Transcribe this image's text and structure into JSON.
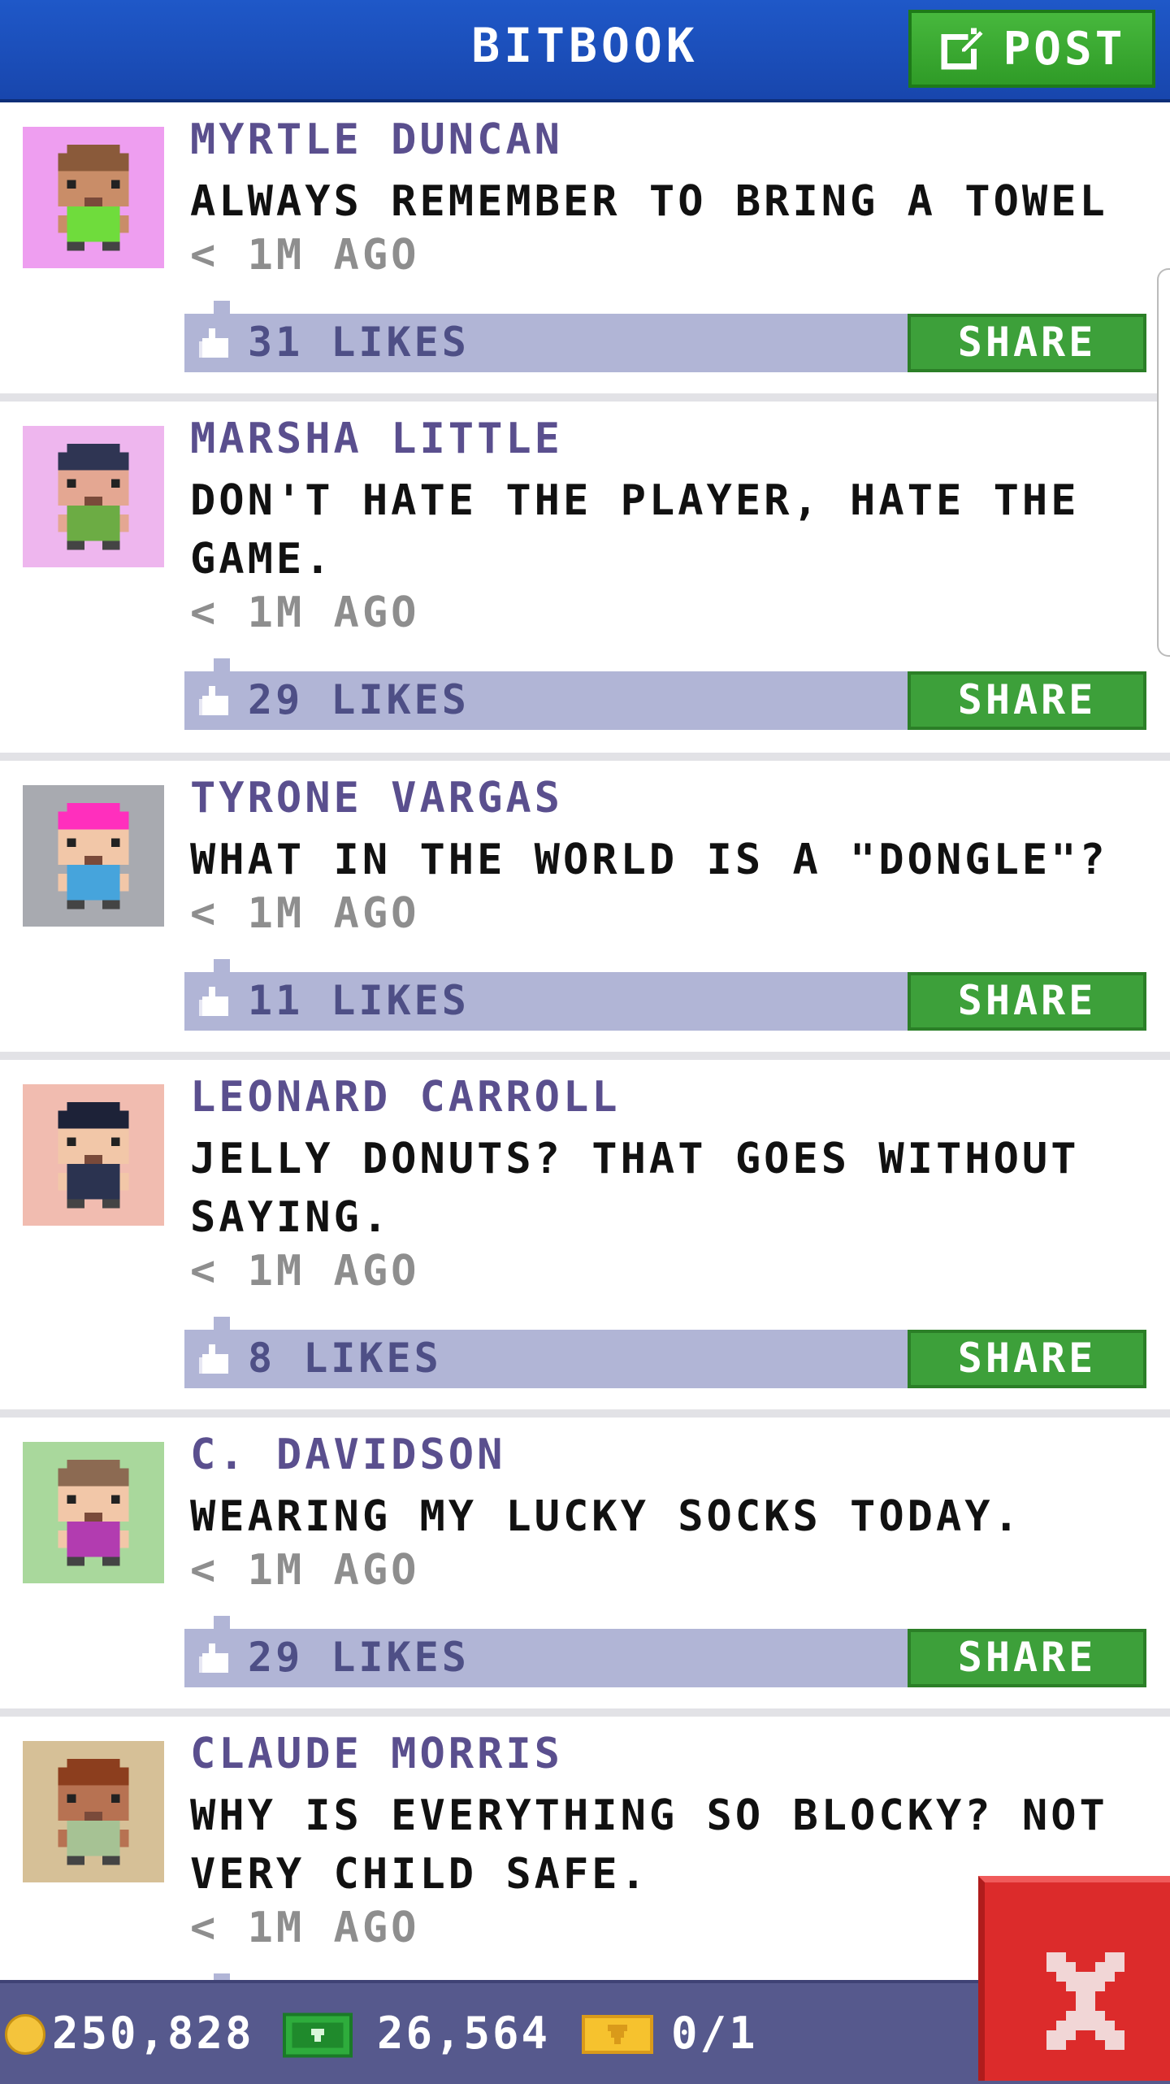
{
  "header": {
    "title": "BITBOOK",
    "post_label": "POST",
    "post_icon": "edit-icon"
  },
  "posts": [
    {
      "author": "MYRTLE DUNCAN",
      "message": "ALWAYS REMEMBER TO BRING A TOWEL",
      "time": "< 1M AGO",
      "likes": "31 LIKES",
      "share": "SHARE",
      "avatar_bg": "#ee9ef0",
      "avatar_skin": "#c98d68",
      "avatar_hair": "#8a5a3a",
      "avatar_shirt": "#6fdc3c"
    },
    {
      "author": "MARSHA LITTLE",
      "message": "DON'T HATE THE PLAYER, HATE THE GAME.",
      "time": "< 1M AGO",
      "likes": "29 LIKES",
      "share": "SHARE",
      "avatar_bg": "#eeb6ee",
      "avatar_skin": "#e4a792",
      "avatar_hair": "#2f3553",
      "avatar_shirt": "#6cac44"
    },
    {
      "author": "TYRONE VARGAS",
      "message": "WHAT IN THE WORLD IS A \"DONGLE\"?",
      "time": "< 1M AGO",
      "likes": "11 LIKES",
      "share": "SHARE",
      "avatar_bg": "#a8aab0",
      "avatar_skin": "#f2c7a8",
      "avatar_hair": "#ff2fbd",
      "avatar_shirt": "#46a4dc"
    },
    {
      "author": "LEONARD CARROLL",
      "message": "JELLY DONUTS? THAT GOES WITHOUT SAYING.",
      "time": "< 1M AGO",
      "likes": "8 LIKES",
      "share": "SHARE",
      "avatar_bg": "#f1bcb0",
      "avatar_skin": "#f2c7a8",
      "avatar_hair": "#1d2238",
      "avatar_shirt": "#2b3350"
    },
    {
      "author": "C. DAVIDSON",
      "message": "WEARING MY LUCKY SOCKS TODAY.",
      "time": "< 1M AGO",
      "likes": "29 LIKES",
      "share": "SHARE",
      "avatar_bg": "#a9d89c",
      "avatar_skin": "#f2c7a8",
      "avatar_hair": "#8c6a52",
      "avatar_shirt": "#b23cb0"
    },
    {
      "author": "CLAUDE MORRIS",
      "message": "WHY IS EVERYTHING SO BLOCKY? NOT VERY CHILD SAFE.",
      "time": "< 1M AGO",
      "likes": "",
      "share": "",
      "avatar_bg": "#d6c097",
      "avatar_skin": "#b77252",
      "avatar_hair": "#8c3e1e",
      "avatar_shirt": "#a6c294"
    }
  ],
  "status": {
    "coins": "250,828",
    "cash": "26,564",
    "tickets": "0/1",
    "coin_icon": "coin-icon",
    "cash_icon": "cash-icon",
    "ticket_icon": "ticket-icon"
  },
  "close_icon": "close-icon",
  "colors": {
    "header": "#1f58c8",
    "post_button": "#3da03a",
    "like_bar": "#b1b5d6",
    "author_text": "#5a4f8e",
    "close_button": "#dc2b2b"
  }
}
